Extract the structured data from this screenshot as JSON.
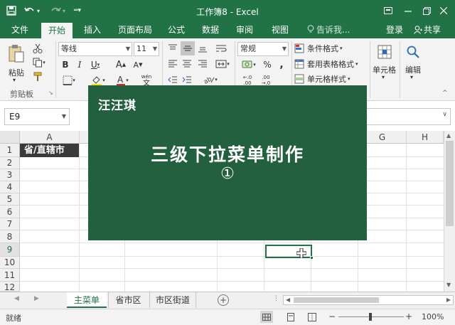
{
  "window": {
    "title": "工作簿8 - Excel"
  },
  "tabs": [
    "文件",
    "开始",
    "插入",
    "页面布局",
    "公式",
    "数据",
    "审阅",
    "视图"
  ],
  "active_tab": "开始",
  "tell_me": "告诉我...",
  "account": {
    "login": "登录",
    "share": "共享"
  },
  "ribbon": {
    "clipboard": {
      "paste": "粘贴",
      "group": "剪贴板"
    },
    "font": {
      "name": "等线",
      "size": "11"
    },
    "number": {
      "format": "常规"
    },
    "styles": {
      "conditional": "条件格式",
      "table": "套用表格格式",
      "cell": "单元格样式"
    },
    "cells": "单元格",
    "editing": "编辑"
  },
  "namebox": "E9",
  "columns": [
    "A",
    "G",
    "H"
  ],
  "rows": [
    "1",
    "2",
    "3",
    "4",
    "5",
    "6",
    "7",
    "8",
    "9",
    "10",
    "11",
    "12"
  ],
  "cell_a1": "省/直辖市",
  "overlay": {
    "author": "汪汪琪",
    "title": "三级下拉菜单制作",
    "number": "①"
  },
  "sheets": [
    "主菜单",
    "省市区",
    "市区街道"
  ],
  "active_sheet": "主菜单",
  "status": {
    "ready": "就绪",
    "zoom": "100%"
  },
  "colors": {
    "excel_green": "#217346",
    "overlay_green": "#22603f"
  }
}
